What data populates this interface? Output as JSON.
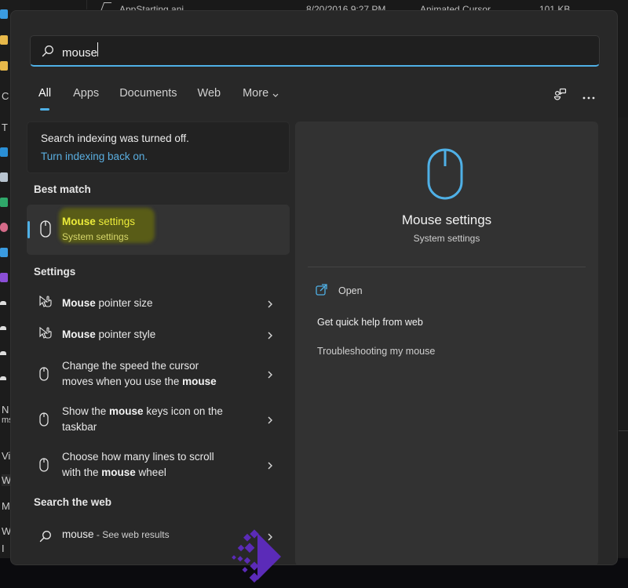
{
  "background": {
    "explorer_row": {
      "name": "AppStarting.ani",
      "date": "8/20/2016 9:27 PM",
      "type": "Animated Cursor",
      "size": "101 KB"
    },
    "left_strip_labels": [
      "C",
      "T",
      "N",
      "ms",
      "Vi",
      "W",
      "M",
      "W",
      "I"
    ]
  },
  "search": {
    "query": "mouse",
    "icon": "search-icon"
  },
  "tabs": [
    {
      "label": "All",
      "active": true
    },
    {
      "label": "Apps",
      "active": false
    },
    {
      "label": "Documents",
      "active": false
    },
    {
      "label": "Web",
      "active": false
    },
    {
      "label": "More",
      "active": false,
      "icon": "chevron-down-icon"
    }
  ],
  "toolbar": {
    "feedback_icon": "feedback-icon",
    "more_icon": "more-options-icon"
  },
  "indexing_notice": {
    "title": "Search indexing was turned off.",
    "link": "Turn indexing back on."
  },
  "best_match": {
    "heading": "Best match",
    "title_bold": "Mouse",
    "title_rest": " settings",
    "subtitle": "System settings",
    "icon": "mouse-icon",
    "highlight_color": "#e6e62e"
  },
  "settings": {
    "heading": "Settings",
    "items": [
      {
        "icon": "pointer-icon",
        "parts": [
          {
            "b": "Mouse"
          },
          {
            "t": " pointer size"
          }
        ]
      },
      {
        "icon": "pointer-icon",
        "parts": [
          {
            "b": "Mouse"
          },
          {
            "t": " pointer style"
          }
        ]
      },
      {
        "icon": "mouse-icon",
        "line1": "Change the speed the cursor",
        "line2_pre": "moves when you use the ",
        "line2_bold": "mouse",
        "line2_post": ""
      },
      {
        "icon": "mouse-icon",
        "line1_pre": "Show the ",
        "line1_bold": "mouse",
        "line1_post": " keys icon on the",
        "line2": "taskbar"
      },
      {
        "icon": "mouse-icon",
        "line1": "Choose how many lines to scroll",
        "line2_pre": "with the ",
        "line2_bold": "mouse",
        "line2_post": " wheel"
      }
    ]
  },
  "web": {
    "heading": "Search the web",
    "query": "mouse",
    "suffix": " - See web results",
    "icon": "search-icon"
  },
  "detail": {
    "title": "Mouse settings",
    "subtitle": "System settings",
    "icon": "mouse-icon",
    "actions": [
      {
        "label": "Open",
        "icon": "open-external-icon"
      },
      {
        "label": "Get quick help from web"
      },
      {
        "label": "Troubleshooting my mouse"
      }
    ]
  },
  "colors": {
    "accent": "#4fb0e6",
    "popup_bg": "#282828",
    "detail_bg": "#323232",
    "watermark": "#5b2bb8"
  }
}
